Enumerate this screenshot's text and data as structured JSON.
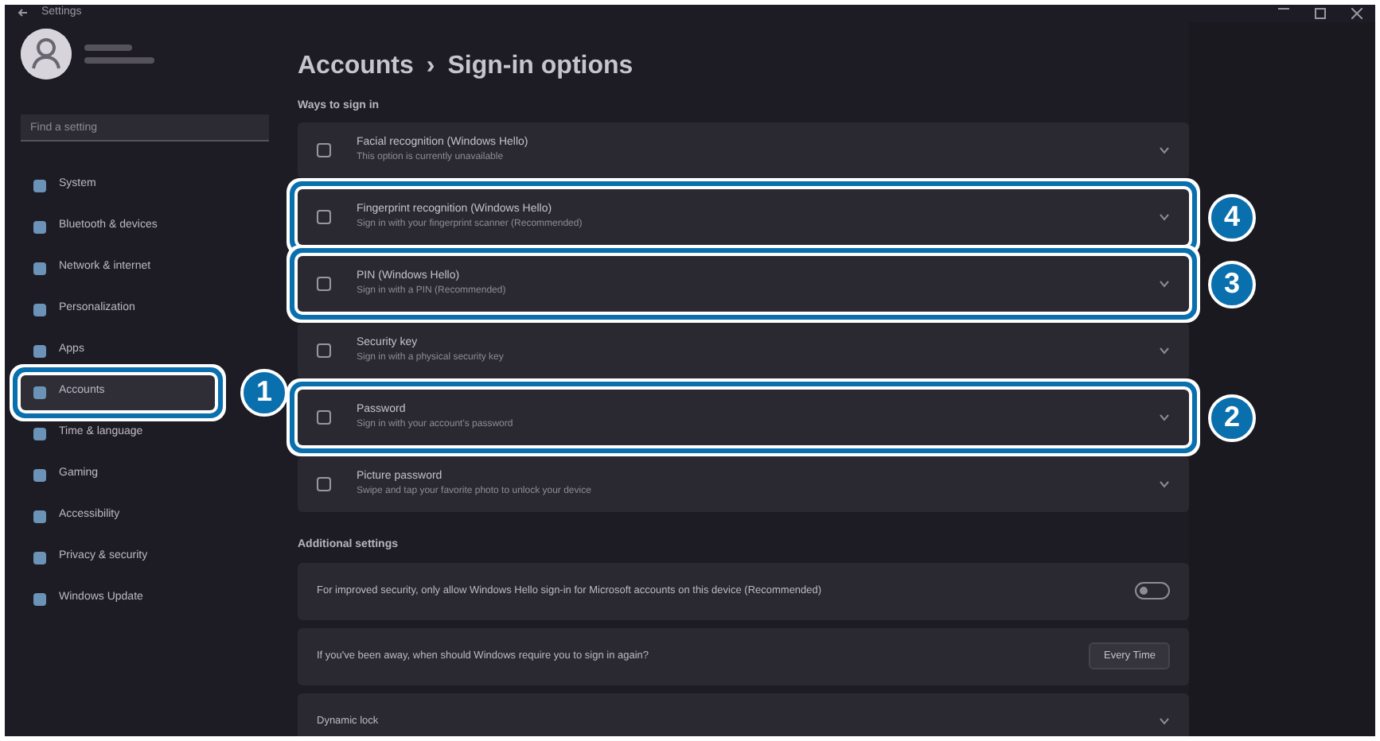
{
  "window": {
    "title": "Settings"
  },
  "sidebar": {
    "search": {
      "placeholder": "Find a setting"
    },
    "items": [
      {
        "label": "System",
        "selected": false
      },
      {
        "label": "Bluetooth & devices",
        "selected": false
      },
      {
        "label": "Network & internet",
        "selected": false
      },
      {
        "label": "Personalization",
        "selected": false
      },
      {
        "label": "Apps",
        "selected": false
      },
      {
        "label": "Accounts",
        "selected": true,
        "callout": "1"
      },
      {
        "label": "Time & language",
        "selected": false
      },
      {
        "label": "Gaming",
        "selected": false
      },
      {
        "label": "Accessibility",
        "selected": false
      },
      {
        "label": "Privacy & security",
        "selected": false
      },
      {
        "label": "Windows Update",
        "selected": false
      }
    ]
  },
  "breadcrumb": {
    "parent": "Accounts",
    "separator": "›",
    "current": "Sign-in options"
  },
  "ways_to_sign_in": {
    "heading": "Ways to sign in",
    "rows": [
      {
        "title": "Facial recognition (Windows Hello)",
        "subtitle": "This option is currently unavailable"
      },
      {
        "title": "Fingerprint recognition (Windows Hello)",
        "subtitle": "Sign in with your fingerprint scanner (Recommended)",
        "callout": "4"
      },
      {
        "title": "PIN (Windows Hello)",
        "subtitle": "Sign in with a PIN (Recommended)",
        "callout": "3"
      },
      {
        "title": "Security key",
        "subtitle": "Sign in with a physical security key"
      },
      {
        "title": "Password",
        "subtitle": "Sign in with your account's password",
        "callout": "2"
      },
      {
        "title": "Picture password",
        "subtitle": "Swipe and tap your favorite photo to unlock your device"
      }
    ]
  },
  "additional_settings": {
    "heading": "Additional settings",
    "rows": [
      {
        "kind": "toggle",
        "label": "For improved security, only allow Windows Hello sign-in for Microsoft accounts on this device (Recommended)",
        "on": false
      },
      {
        "kind": "dropdown",
        "label": "If you've been away, when should Windows require you to sign in again?",
        "value": "Every Time"
      },
      {
        "kind": "expand",
        "label": "Dynamic lock"
      }
    ]
  }
}
